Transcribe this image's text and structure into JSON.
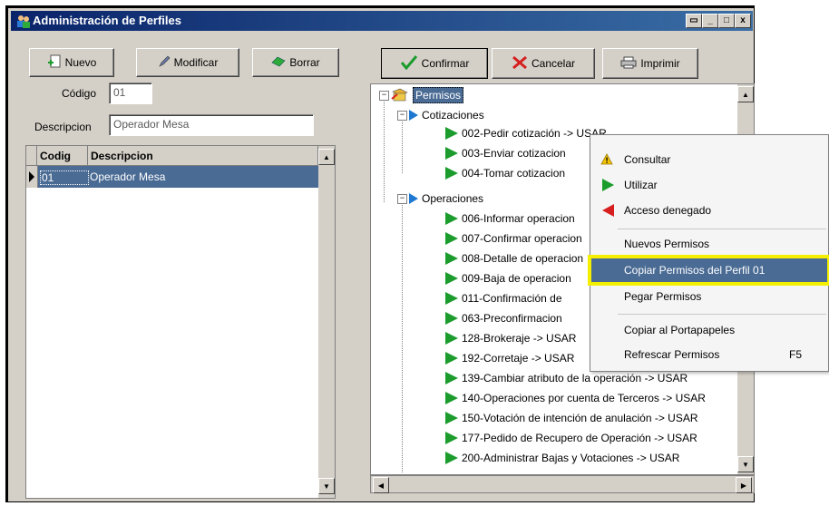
{
  "window": {
    "title": "Administración de Perfiles",
    "controls": [
      "▭",
      "_",
      "□",
      "x"
    ]
  },
  "left_toolbar": {
    "nuevo": "Nuevo",
    "modificar": "Modificar",
    "borrar": "Borrar"
  },
  "form": {
    "codigo_label": "Código",
    "codigo_value": "01",
    "descripcion_label": "Descripcion",
    "descripcion_value": "Operador Mesa"
  },
  "grid": {
    "columns": [
      "Codig",
      "Descripcion"
    ],
    "rows": [
      {
        "codigo": "01",
        "descripcion": "Operador Mesa"
      }
    ]
  },
  "right_toolbar": {
    "confirmar": "Confirmar",
    "cancelar": "Cancelar",
    "imprimir": "Imprimir"
  },
  "tree": {
    "root": "Permisos",
    "groups": [
      {
        "label": "Cotizaciones",
        "items": [
          "002-Pedir cotización -> USAR",
          "003-Enviar cotizacion",
          "004-Tomar cotizacion"
        ]
      },
      {
        "label": "Operaciones",
        "items": [
          "006-Informar operacion",
          "007-Confirmar operacion",
          "008-Detalle de operacion",
          "009-Baja de operacion",
          "011-Confirmación de",
          "063-Preconfirmacion",
          "128-Brokeraje -> USAR",
          "192-Corretaje -> USAR",
          "139-Cambiar atributo de la operación -> USAR",
          "140-Operaciones por cuenta de Terceros -> USAR",
          "150-Votación de intención de anulación -> USAR",
          "177-Pedido de Recupero de Operación -> USAR",
          "200-Administrar Bajas y Votaciones -> USAR"
        ]
      }
    ]
  },
  "context_menu": {
    "consultar": "Consultar",
    "utilizar": "Utilizar",
    "acceso_denegado": "Acceso denegado",
    "nuevos_permisos": "Nuevos Permisos",
    "copiar_permisos": "Copiar Permisos del Perfil 01",
    "pegar_permisos": "Pegar Permisos",
    "copiar_portapapeles": "Copiar al Portapapeles",
    "refrescar_permisos": "Refrescar Permisos",
    "refrescar_shortcut": "F5"
  },
  "colors": {
    "titlebar": "#0a246a",
    "selection": "#4a6b94",
    "highlight_box": "#f4ef00",
    "green_arrow": "#1b9c2c",
    "blue_arrow": "#1e78d2"
  }
}
